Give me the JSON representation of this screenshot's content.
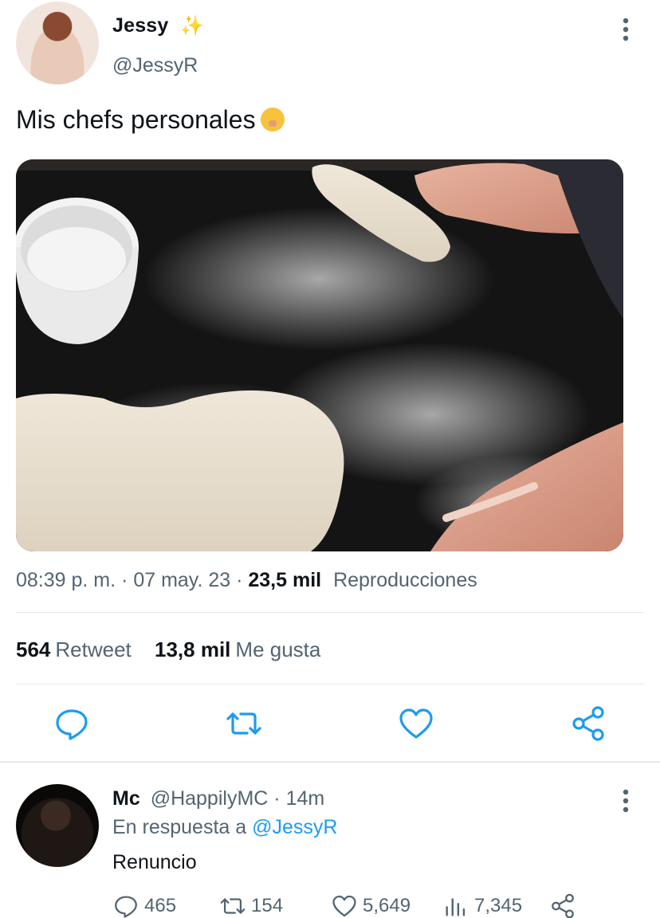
{
  "tweet": {
    "display_name": "Jessy",
    "name_emoji": "✨",
    "handle": "@JessyR",
    "text": "Mis chefs personales",
    "time": "08:39 p. m.",
    "date": "07 may. 23",
    "views_count": "23,5 mil",
    "views_label": "Reproducciones",
    "retweets_count": "564",
    "retweets_label": "Retweet",
    "likes_count": "13,8 mil",
    "likes_label": "Me gusta",
    "separator": "·"
  },
  "actions": {
    "reply_icon": "reply-icon",
    "retweet_icon": "retweet-icon",
    "like_icon": "heart-icon",
    "share_icon": "share-icon"
  },
  "reply": {
    "display_name": "Mc",
    "handle": "@HappilyMC",
    "time": "14m",
    "in_reply_prefix": "En respuesta a",
    "in_reply_handle": "@JessyR",
    "text": "Renuncio",
    "replies": "465",
    "retweets": "154",
    "likes": "5,649",
    "views": "7,345"
  },
  "colors": {
    "text": "#0f1419",
    "secondary": "#536471",
    "link": "#1d9bf0",
    "divider": "#e6e9ec"
  }
}
